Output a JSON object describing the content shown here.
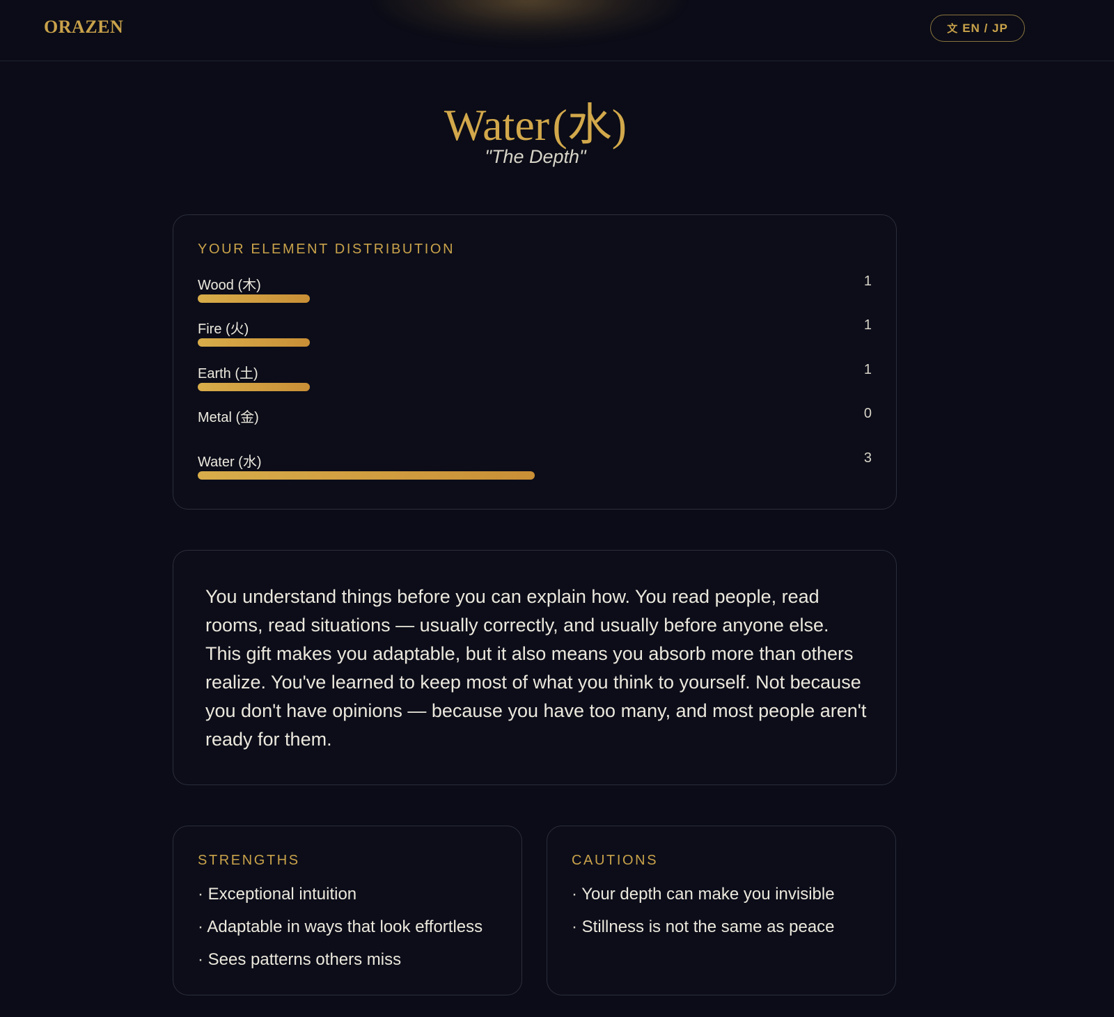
{
  "header": {
    "logo": "ORAZEN",
    "lang_toggle_label": "EN / JP"
  },
  "hero": {
    "title": "Water",
    "title_kanji": "(水)",
    "subtitle": "\"The Depth\""
  },
  "distribution": {
    "heading": "YOUR ELEMENT DISTRIBUTION",
    "max_value": 3,
    "items": [
      {
        "label": "Wood (木)",
        "value": 1,
        "display": "1"
      },
      {
        "label": "Fire (火)",
        "value": 1,
        "display": "1"
      },
      {
        "label": "Earth (土)",
        "value": 1,
        "display": "1"
      },
      {
        "label": "Metal (金)",
        "value": 0,
        "display": "0"
      },
      {
        "label": "Water (水)",
        "value": 3,
        "display": "3"
      }
    ]
  },
  "description": "You understand things before you can explain how. You read people, read rooms, read situations — usually correctly, and usually before anyone else. This gift makes you adaptable, but it also means you absorb more than others realize. You've learned to keep most of what you think to yourself. Not because you don't have opinions — because you have too many, and most people aren't ready for them.",
  "strengths": {
    "heading": "STRENGTHS",
    "items": [
      "Exceptional intuition",
      "Adaptable in ways that look effortless",
      "Sees patterns others miss"
    ]
  },
  "cautions": {
    "heading": "CAUTIONS",
    "items": [
      "Your depth can make you invisible",
      "Stillness is not the same as peace"
    ]
  },
  "colors": {
    "background": "#0b0c17",
    "accent_gold": "#c9a24a",
    "card_border": "#2c2e3c"
  }
}
